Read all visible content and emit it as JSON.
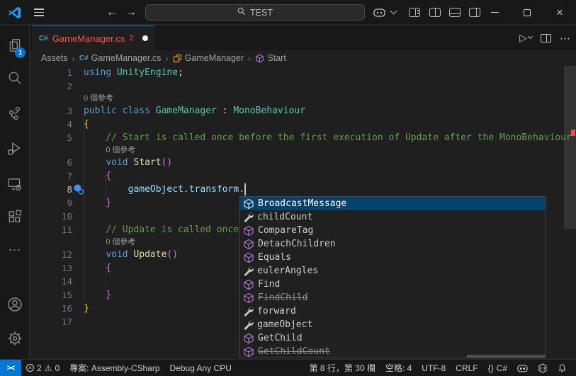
{
  "titlebar": {
    "search_label": "TEST",
    "back": "←",
    "forward": "→",
    "close": "×"
  },
  "tab": {
    "file_name": "GameManager.cs",
    "problem_count": "2",
    "run_glyph": "▷",
    "more_glyph": "⋯"
  },
  "breadcrumb": {
    "items": [
      "Assets",
      "GameManager.cs",
      "GameManager",
      "Start"
    ],
    "separator": "›"
  },
  "activity_bar": {
    "explorer_badge": "1",
    "more_glyph": "⋯"
  },
  "editor": {
    "codelens_label": "0 個參考",
    "rows": [
      {
        "type": "code",
        "n": "1",
        "tokens": [
          [
            "kw",
            "using"
          ],
          [
            "pun",
            " "
          ],
          [
            "type",
            "UnityEngine"
          ],
          [
            "pun",
            ";"
          ]
        ]
      },
      {
        "type": "code",
        "n": "2",
        "tokens": []
      },
      {
        "type": "lens",
        "indent": 0
      },
      {
        "type": "code",
        "n": "3",
        "tokens": [
          [
            "kw",
            "public"
          ],
          [
            "pun",
            " "
          ],
          [
            "kw",
            "class"
          ],
          [
            "pun",
            " "
          ],
          [
            "type",
            "GameManager"
          ],
          [
            "pun",
            " : "
          ],
          [
            "type",
            "MonoBehaviour"
          ]
        ]
      },
      {
        "type": "code",
        "n": "4",
        "tokens": [
          [
            "b1",
            "{"
          ]
        ]
      },
      {
        "type": "code",
        "n": "5",
        "tokens": [
          [
            "com",
            "    // Start is called once before the first execution of Update after the MonoBehaviour is created."
          ]
        ]
      },
      {
        "type": "lens",
        "indent": 4
      },
      {
        "type": "code",
        "n": "6",
        "tokens": [
          [
            "pun",
            "    "
          ],
          [
            "kw",
            "void"
          ],
          [
            "pun",
            " "
          ],
          [
            "fn",
            "Start"
          ],
          [
            "b2",
            "()"
          ]
        ]
      },
      {
        "type": "code",
        "n": "7",
        "tokens": [
          [
            "pun",
            "    "
          ],
          [
            "b2",
            "{"
          ]
        ]
      },
      {
        "type": "code",
        "n": "8",
        "active": true,
        "tokens": [
          [
            "pun",
            "        "
          ],
          [
            "var",
            "gameObject"
          ],
          [
            "pun",
            "."
          ],
          [
            "var",
            "transform"
          ],
          [
            "pun",
            "."
          ]
        ]
      },
      {
        "type": "code",
        "n": "9",
        "tokens": [
          [
            "pun",
            "    "
          ],
          [
            "b2",
            "}"
          ]
        ]
      },
      {
        "type": "code",
        "n": "10",
        "tokens": []
      },
      {
        "type": "code",
        "n": "11",
        "tokens": [
          [
            "com",
            "    // Update is called once per frame"
          ]
        ]
      },
      {
        "type": "lens",
        "indent": 4
      },
      {
        "type": "code",
        "n": "12",
        "tokens": [
          [
            "pun",
            "    "
          ],
          [
            "kw",
            "void"
          ],
          [
            "pun",
            " "
          ],
          [
            "fn",
            "Update"
          ],
          [
            "b2",
            "()"
          ]
        ]
      },
      {
        "type": "code",
        "n": "13",
        "tokens": [
          [
            "pun",
            "    "
          ],
          [
            "b2",
            "{"
          ]
        ]
      },
      {
        "type": "code",
        "n": "14",
        "tokens": []
      },
      {
        "type": "code",
        "n": "15",
        "tokens": [
          [
            "pun",
            "    "
          ],
          [
            "b2",
            "}"
          ]
        ]
      },
      {
        "type": "code",
        "n": "16",
        "tokens": [
          [
            "b1",
            "}"
          ]
        ]
      },
      {
        "type": "code",
        "n": "17",
        "tokens": []
      }
    ]
  },
  "suggest": {
    "items": [
      {
        "label": "BroadcastMessage",
        "kind": "method",
        "selected": true,
        "deprecated": false
      },
      {
        "label": "childCount",
        "kind": "property",
        "selected": false,
        "deprecated": false
      },
      {
        "label": "CompareTag",
        "kind": "method",
        "selected": false,
        "deprecated": false
      },
      {
        "label": "DetachChildren",
        "kind": "method",
        "selected": false,
        "deprecated": false
      },
      {
        "label": "Equals",
        "kind": "method",
        "selected": false,
        "deprecated": false
      },
      {
        "label": "eulerAngles",
        "kind": "property",
        "selected": false,
        "deprecated": false
      },
      {
        "label": "Find",
        "kind": "method",
        "selected": false,
        "deprecated": false
      },
      {
        "label": "FindChild",
        "kind": "method",
        "selected": false,
        "deprecated": true
      },
      {
        "label": "forward",
        "kind": "property",
        "selected": false,
        "deprecated": false
      },
      {
        "label": "gameObject",
        "kind": "property",
        "selected": false,
        "deprecated": false
      },
      {
        "label": "GetChild",
        "kind": "method",
        "selected": false,
        "deprecated": false
      },
      {
        "label": "GetChildCount",
        "kind": "method",
        "selected": false,
        "deprecated": true
      }
    ]
  },
  "status_bar": {
    "remote_glyph": "><",
    "error_count": "2",
    "warning_glyph": "⚠",
    "warning_count": "0",
    "project": "專案: Assembly-CSharp",
    "config": "Debug Any CPU",
    "cursor_position": "第 8 行，第 30 欄",
    "indentation": "空格: 4",
    "encoding": "UTF-8",
    "eol": "CRLF",
    "braces_glyph": "{}",
    "language": "C#"
  },
  "colors": {
    "accent": "#0078d4",
    "error": "#f14c4c",
    "tab_error_text": "#f85149",
    "suggest_selection": "#05426e",
    "method_icon": "#b180d7",
    "property_icon": "#cccccc",
    "class_icon": "#ee9d28",
    "file_icon": "#519aba"
  }
}
